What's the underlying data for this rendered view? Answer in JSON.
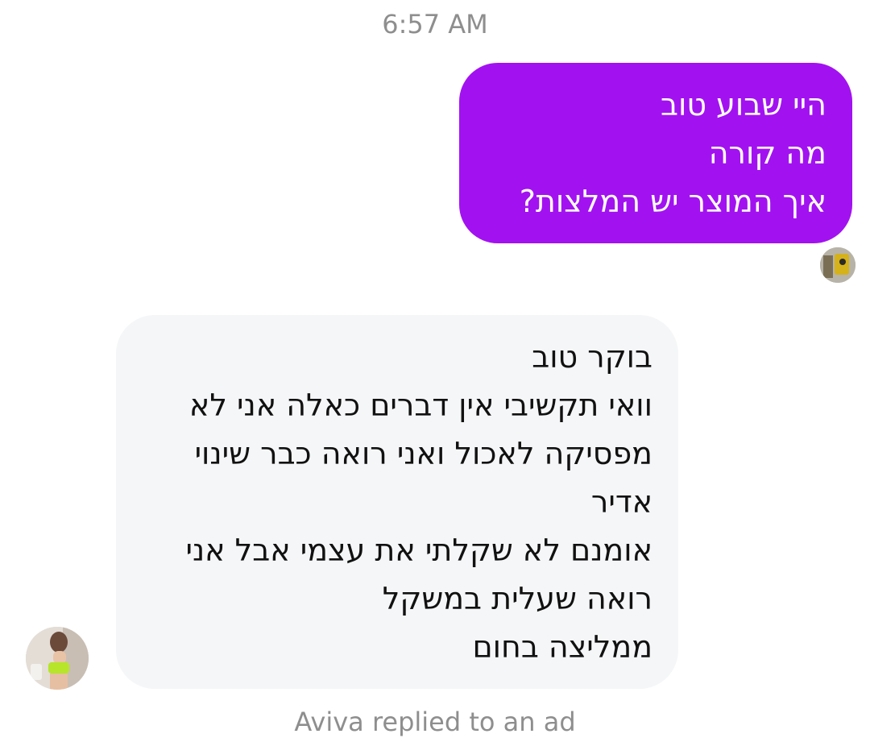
{
  "thread": {
    "timestamp": "6:57 AM",
    "outgoing": {
      "lines": [
        "היי שבוע טוב",
        "מה קורה",
        "איך המוצר יש המלצות?"
      ],
      "color": "#a212f0"
    },
    "incoming": {
      "lines": [
        "בוקר טוב",
        "וואי תקשיבי אין דברים כאלה אני לא",
        "מפסיקה לאכול ואני רואה כבר שינוי",
        "אדיר",
        "אומנם לא שקלתי את עצמי אבל אני",
        "רואה שעלית במשקל",
        "ממליצה בחום"
      ],
      "color": "#f5f6f8"
    },
    "footer_note": "Aviva replied to an ad"
  }
}
